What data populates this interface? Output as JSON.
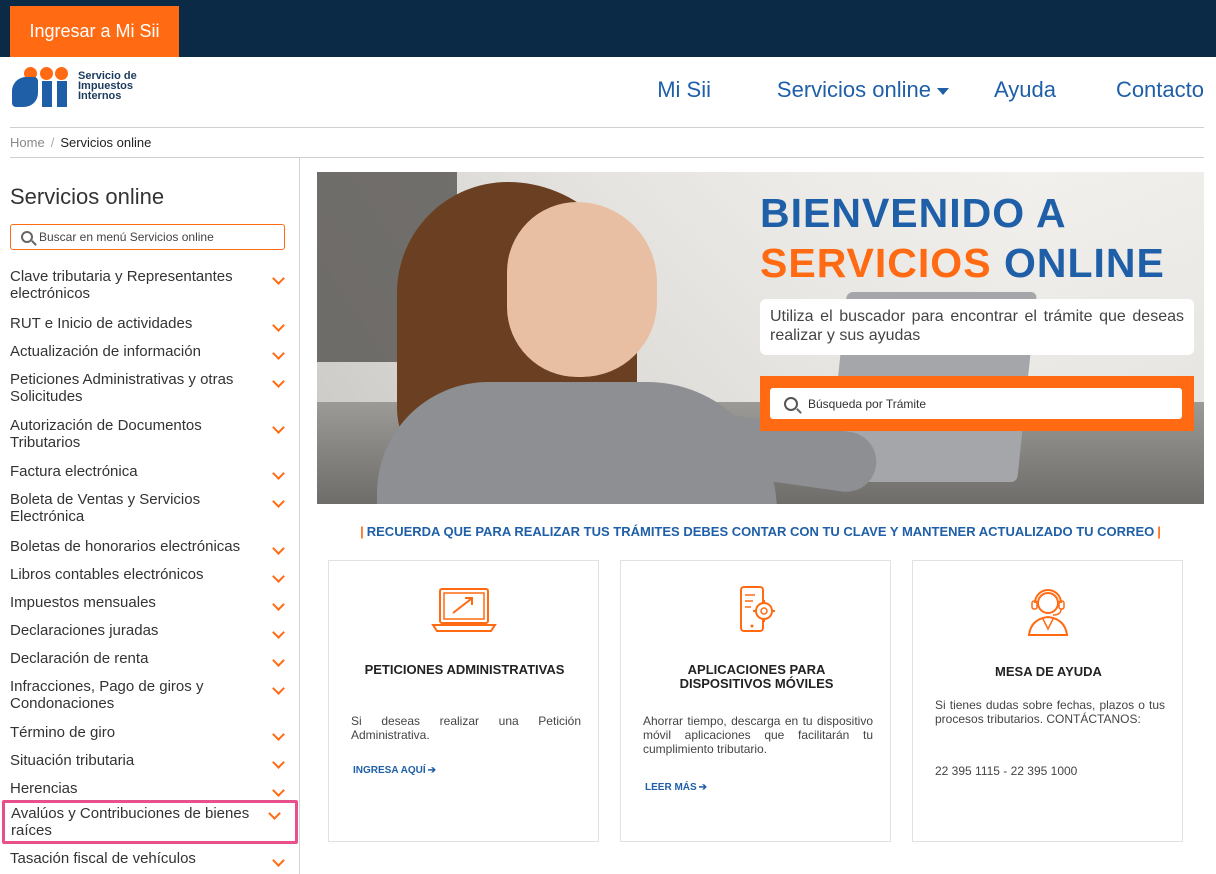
{
  "topbar": {
    "mysii_label": "Ingresar a Mi Sii"
  },
  "logo": {
    "line1": "Servicio de",
    "line2": "Impuestos",
    "line3": "Internos"
  },
  "nav": {
    "mi_sii": "Mi Sii",
    "servicios": "Servicios online",
    "ayuda": "Ayuda",
    "contacto": "Contacto"
  },
  "breadcrumb": {
    "home": "Home",
    "sep": "/",
    "current": "Servicios online"
  },
  "sidebar": {
    "title": "Servicios online",
    "search_placeholder": "Buscar en menú Servicios online",
    "items": [
      {
        "label": "Clave tributaria y Representantes electrónicos"
      },
      {
        "label": "RUT e Inicio de actividades"
      },
      {
        "label": "Actualización de información"
      },
      {
        "label": "Peticiones Administrativas y otras Solicitudes"
      },
      {
        "label": "Autorización de Documentos Tributarios"
      },
      {
        "label": "Factura electrónica"
      },
      {
        "label": "Boleta de Ventas y Servicios Electrónica"
      },
      {
        "label": "Boletas de honorarios electrónicas"
      },
      {
        "label": "Libros contables electrónicos"
      },
      {
        "label": "Impuestos mensuales"
      },
      {
        "label": "Declaraciones juradas"
      },
      {
        "label": "Declaración de renta"
      },
      {
        "label": "Infracciones, Pago de giros y Condonaciones"
      },
      {
        "label": "Término de giro"
      },
      {
        "label": "Situación tributaria"
      },
      {
        "label": "Herencias"
      },
      {
        "label": "Avalúos y Contribuciones de bienes raíces"
      },
      {
        "label": "Tasación fiscal de vehículos"
      }
    ]
  },
  "hero": {
    "title_line1": "BIENVENIDO A",
    "title_line2_orange": "SERVICIOS",
    "title_line2_blue": "ONLINE",
    "description": "Utiliza el buscador para encontrar el trámite que deseas realizar y sus ayudas",
    "search_placeholder": "Búsqueda por Trámite"
  },
  "notice": {
    "bar": "|",
    "text": "RECUERDA QUE PARA REALIZAR TUS TRÁMITES DEBES CONTAR CON TU CLAVE Y MANTENER ACTUALIZADO TU CORREO"
  },
  "cards": [
    {
      "title": "PETICIONES ADMINISTRATIVAS",
      "text": "Si deseas realizar una Petición Administrativa.",
      "link": "INGRESA AQUÍ",
      "icon": "laptop-chart-icon"
    },
    {
      "title": "APLICACIONES PARA DISPOSITIVOS MÓVILES",
      "text": "Ahorrar tiempo, descarga en tu dispositivo móvil aplicaciones que facilitarán tu cumplimiento tributario.",
      "link": "LEER MÁS",
      "icon": "mobile-gear-icon"
    },
    {
      "title": "MESA DE AYUDA",
      "text": "Si tienes dudas sobre fechas, plazos o tus procesos tributarios. CONTÁCTANOS:",
      "phones": "22 395 1115 - 22 395 1000",
      "icon": "headset-agent-icon"
    }
  ],
  "colors": {
    "navy": "#0b2a46",
    "orange": "#ff6a13",
    "blue": "#1f5fa8",
    "highlight": "#e8508c"
  }
}
